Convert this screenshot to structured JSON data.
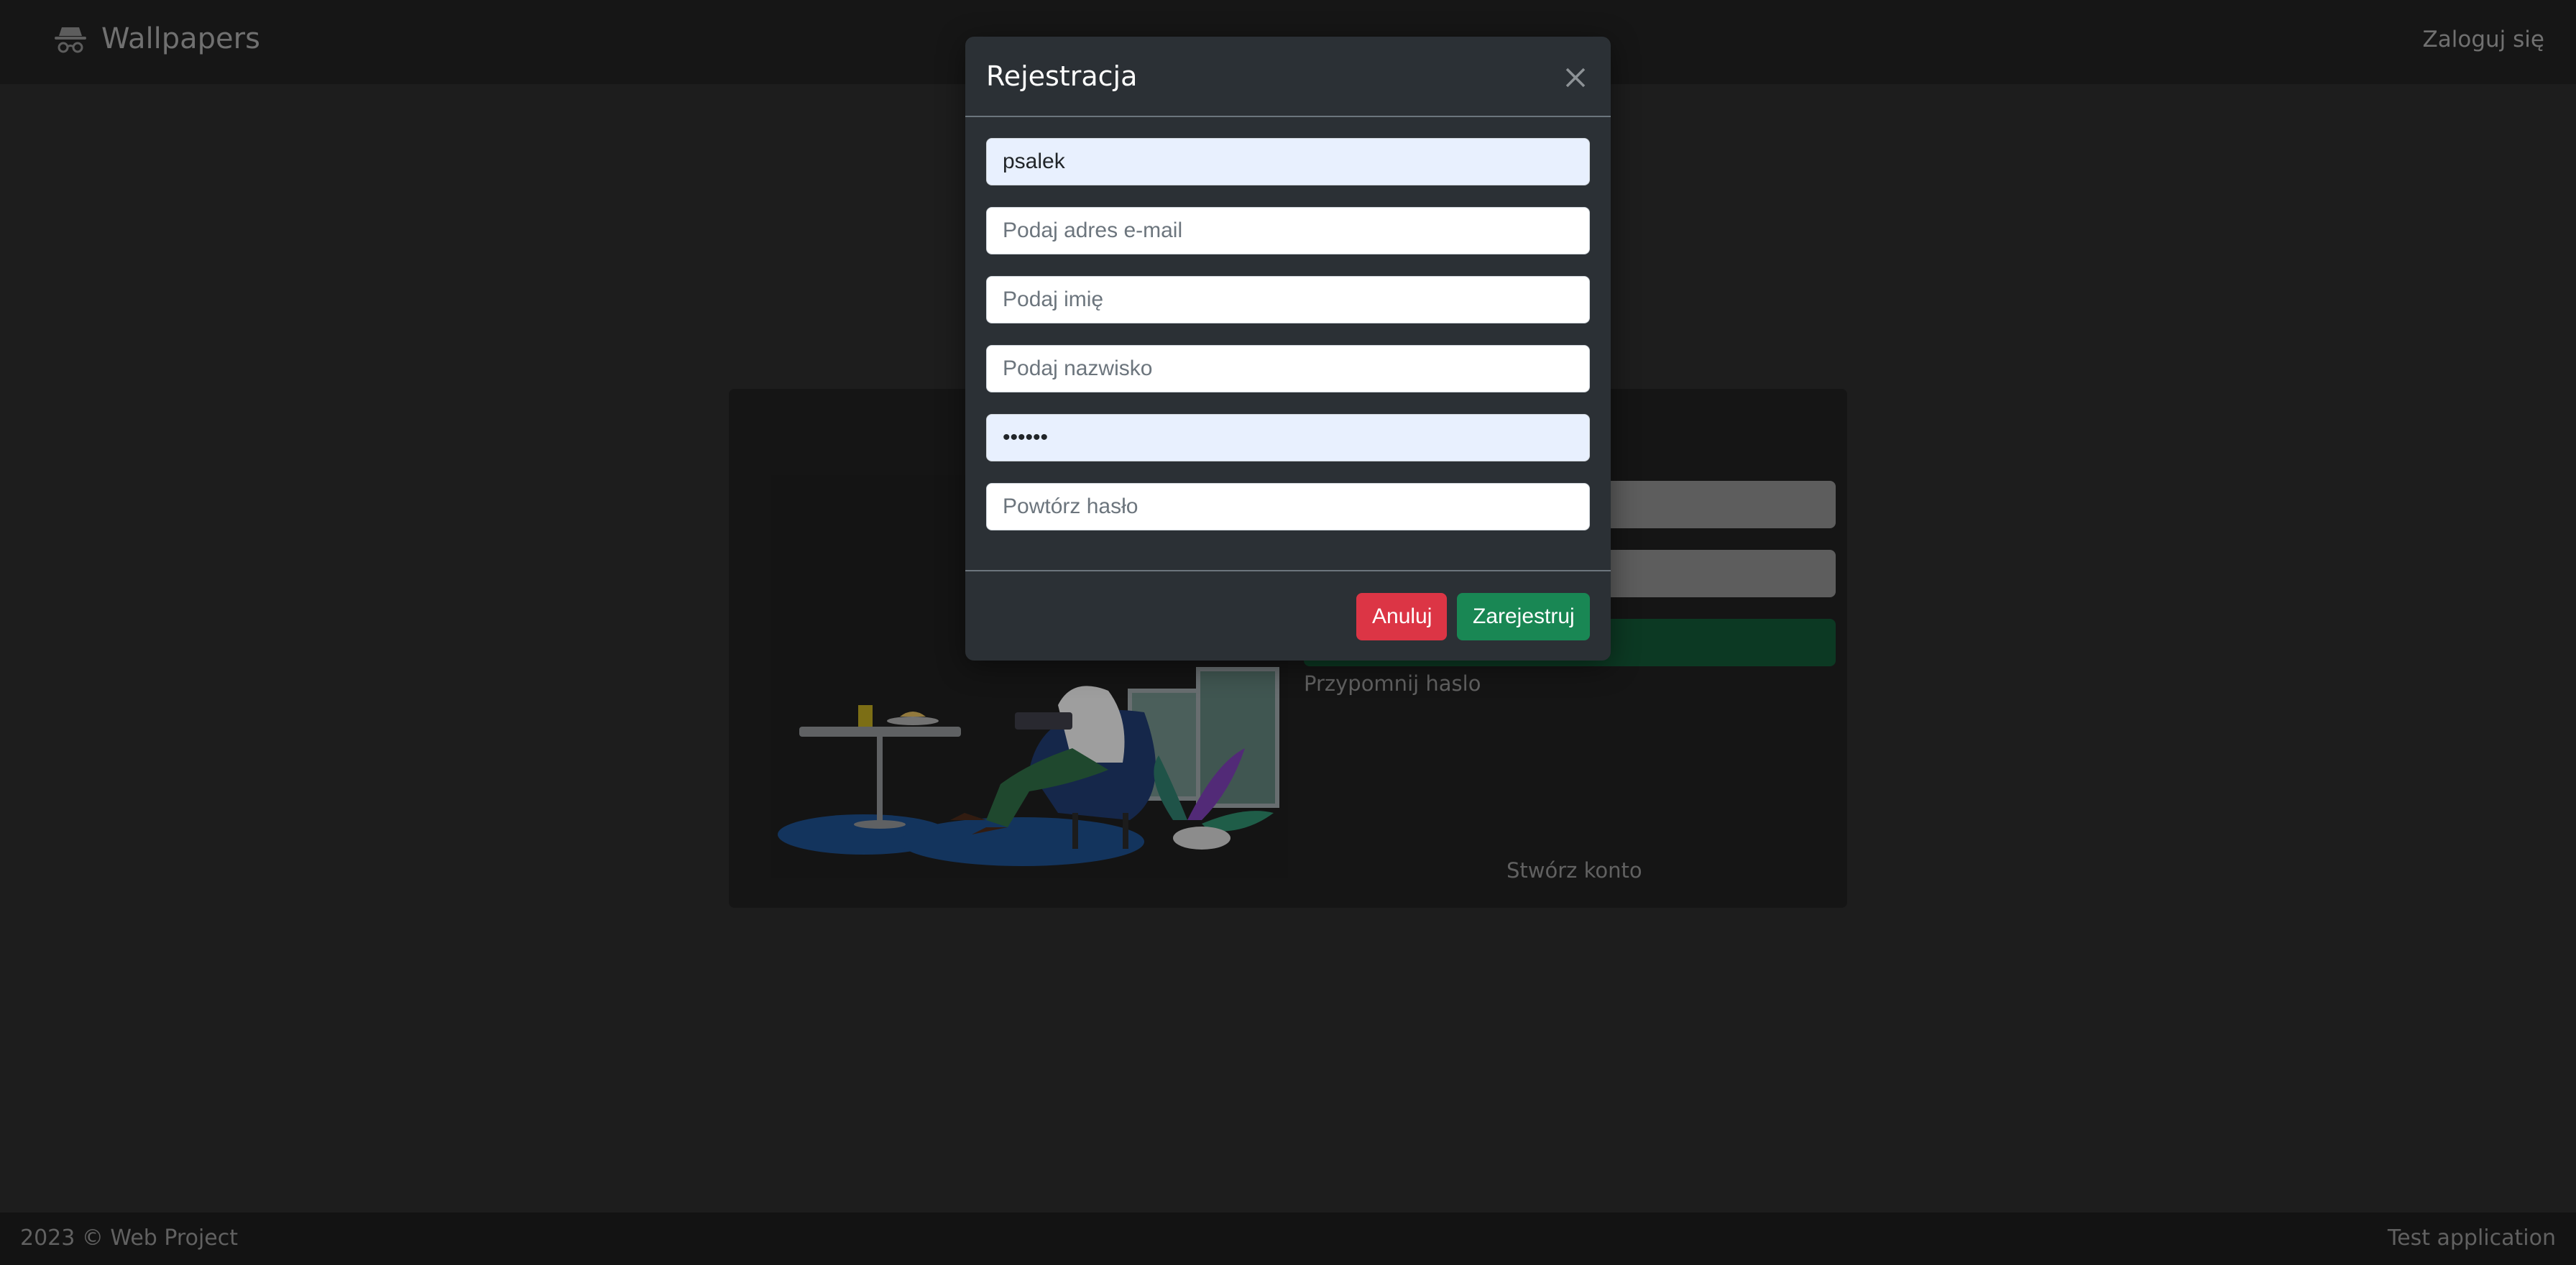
{
  "navbar": {
    "brand": "Wallpapers",
    "brand_icon": "incognito-icon",
    "login": "Zaloguj się"
  },
  "login_card": {
    "remind_password": "Przypomnij haslo",
    "create_account": "Stwórz konto"
  },
  "footer": {
    "left": "2023 © Web Project",
    "right": "Test application"
  },
  "modal": {
    "title": "Rejestracja",
    "fields": {
      "username": {
        "value": "psalek",
        "placeholder": ""
      },
      "email": {
        "value": "",
        "placeholder": "Podaj adres e-mail"
      },
      "first_name": {
        "value": "",
        "placeholder": "Podaj imię"
      },
      "last_name": {
        "value": "",
        "placeholder": "Podaj nazwisko"
      },
      "password": {
        "value": "••••••",
        "placeholder": ""
      },
      "repeat_password": {
        "value": "",
        "placeholder": "Powtórz hasło"
      }
    },
    "cancel_label": "Anuluj",
    "submit_label": "Zarejestruj"
  },
  "colors": {
    "cancel": "#dc3545",
    "submit": "#198754",
    "modal_bg": "#2b3035",
    "page_bg": "#2b2b2b"
  }
}
